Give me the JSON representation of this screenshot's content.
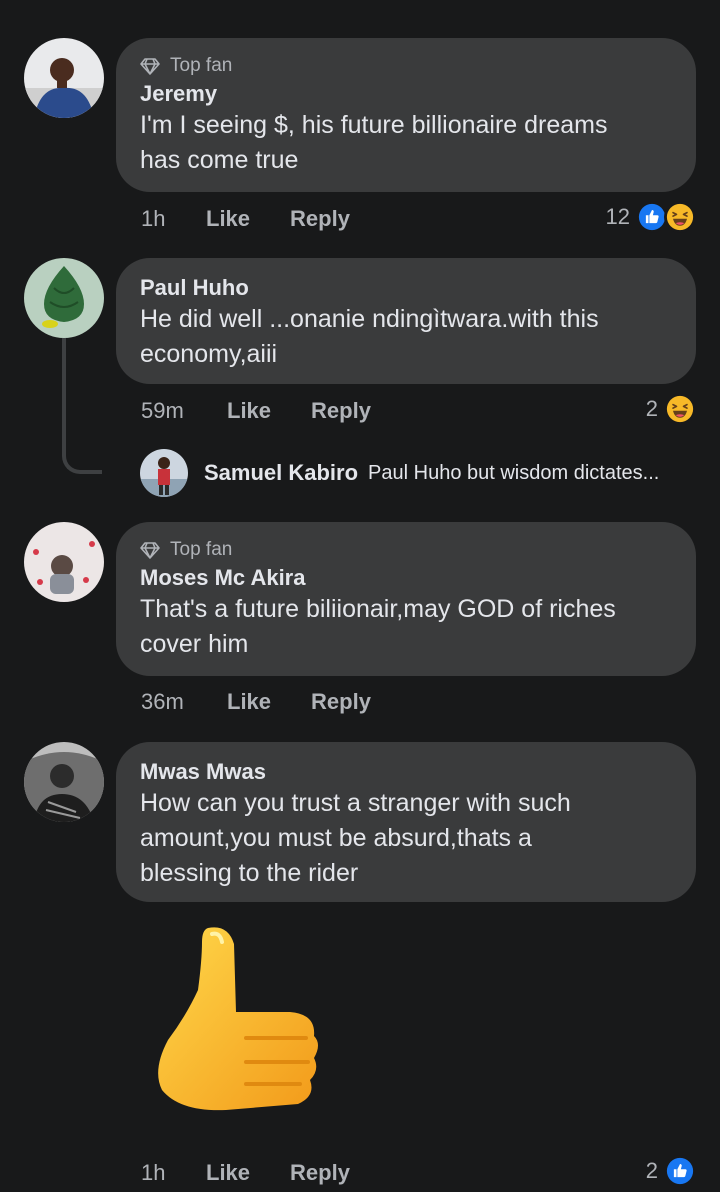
{
  "comments": [
    {
      "badge": "Top fan",
      "author": "Jeremy",
      "text": "I'm I seeing $, his future billionaire dreams\nhas come true",
      "time": "1h",
      "like": "Like",
      "reply": "Reply",
      "reaction_count": "12",
      "reactions": [
        "like-icon",
        "haha-icon"
      ]
    },
    {
      "author": "Paul Huho",
      "text": "He did well ...onanie ndingìtwara.with this\neconomy,aiii",
      "time": "59m",
      "like": "Like",
      "reply": "Reply",
      "reaction_count": "2",
      "reactions": [
        "haha-icon"
      ],
      "reply_preview": {
        "author": "Samuel Kabiro",
        "text": "Paul Huho but wisdom dictates..."
      }
    },
    {
      "badge": "Top fan",
      "author": "Moses Mc Akira",
      "text": "That's a future biliionair,may GOD of riches\ncover him",
      "time": "36m",
      "like": "Like",
      "reply": "Reply"
    },
    {
      "author": "Mwas Mwas",
      "text": "How can you trust a stranger with such\namount,you must be absurd,thats a\nblessing to the rider",
      "sticker": "thumbs-up-sticker",
      "time": "1h",
      "like": "Like",
      "reply": "Reply",
      "reaction_count": "2",
      "reactions": [
        "like-icon"
      ]
    }
  ],
  "colors": {
    "background": "#18191a",
    "bubble": "#3a3b3c",
    "secondary_text": "#b0b3b8",
    "like_blue": "#1877f2",
    "haha_yellow": "#f7b928"
  }
}
